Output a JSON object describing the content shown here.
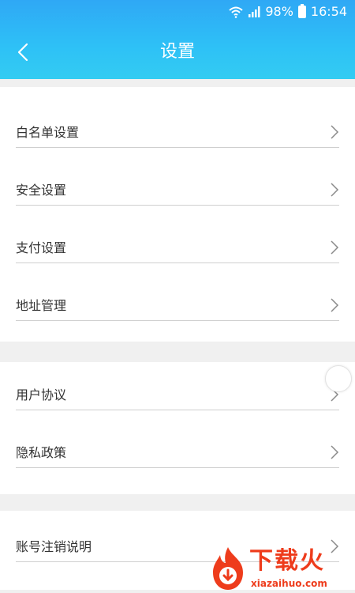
{
  "status_bar": {
    "battery_percent": "98%",
    "time": "16:54"
  },
  "header": {
    "title": "设置"
  },
  "sections": [
    {
      "items": [
        {
          "label": "白名单设置"
        },
        {
          "label": "安全设置"
        },
        {
          "label": "支付设置"
        },
        {
          "label": "地址管理"
        }
      ]
    },
    {
      "items": [
        {
          "label": "用户协议"
        },
        {
          "label": "隐私政策"
        }
      ]
    },
    {
      "items": [
        {
          "label": "账号注销说明"
        }
      ]
    }
  ],
  "watermark": {
    "text_cn": "下载火",
    "text_en": "xiazaihuo.com"
  },
  "colors": {
    "header_start": "#2fa8f5",
    "header_end": "#33ccf2",
    "background": "#f0f0f0",
    "watermark": "#ee3c1c"
  }
}
